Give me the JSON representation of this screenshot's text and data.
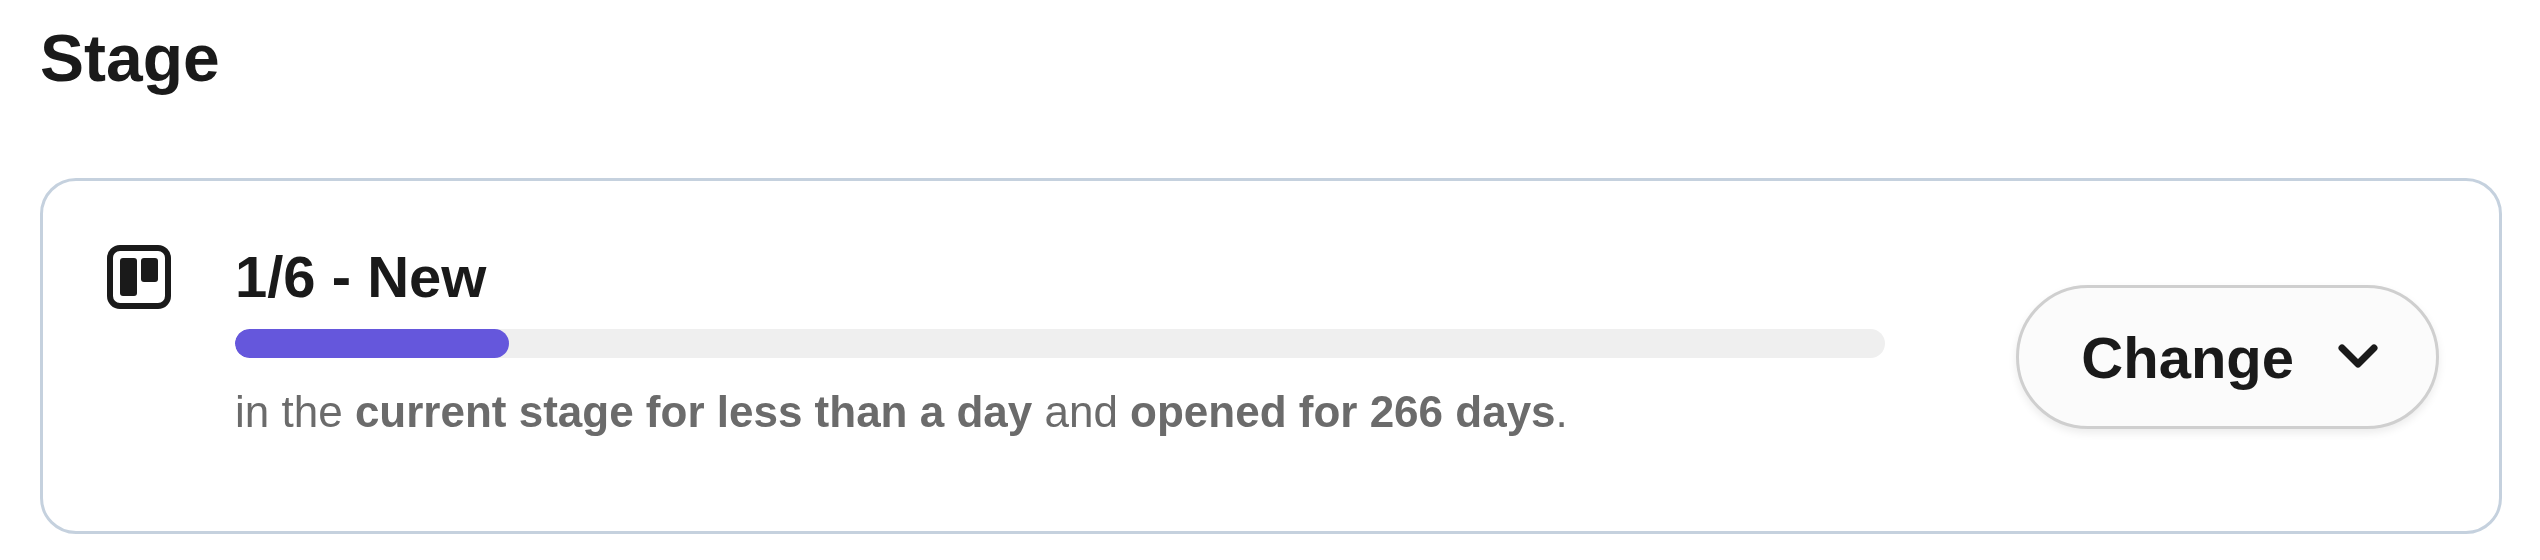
{
  "heading": "Stage",
  "stage": {
    "title": "1/6 - New",
    "level": 0.166,
    "description": "in the **current stage for less than a day** and **opened for 266 days**."
  },
  "change_button": {
    "label": "Change"
  }
}
